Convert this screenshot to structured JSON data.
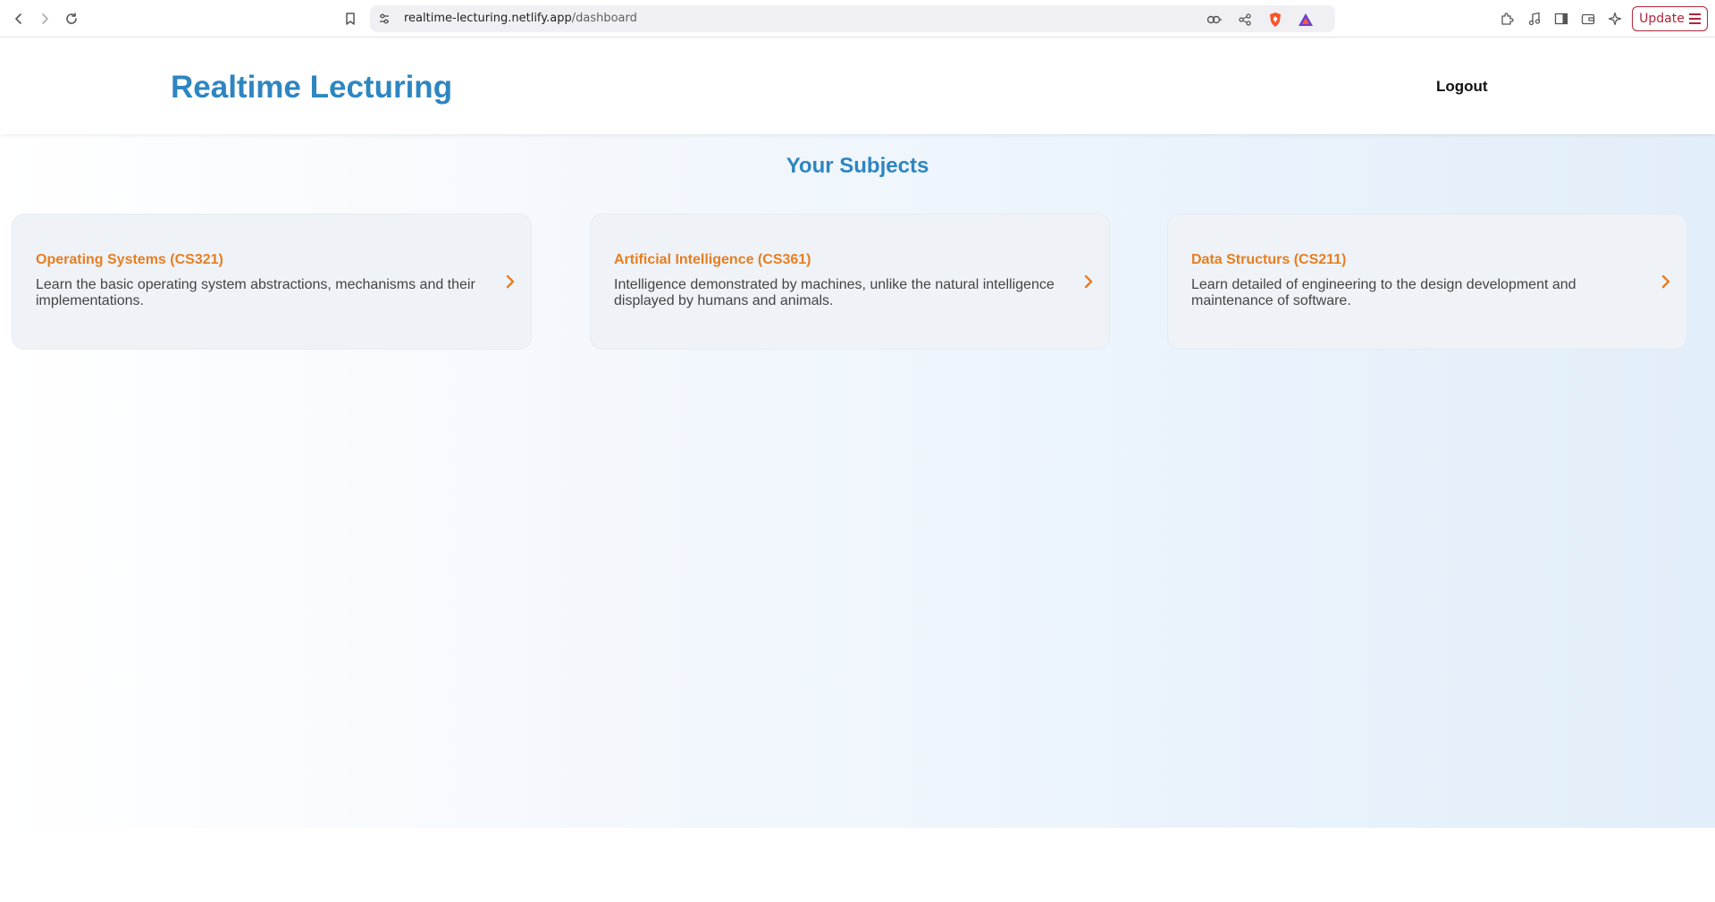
{
  "browser": {
    "url_host": "realtime-lecturing.netlify.app",
    "url_path": "/dashboard",
    "update_label": "Update"
  },
  "header": {
    "title": "Realtime Lecturing",
    "logout_label": "Logout"
  },
  "main": {
    "section_title": "Your Subjects",
    "subjects": [
      {
        "title": "Operating Systems (CS321)",
        "description": "Learn the basic operating system abstractions, mechanisms and their implementations."
      },
      {
        "title": "Artificial Intelligence (CS361)",
        "description": "Intelligence demonstrated by machines, unlike the natural intelligence displayed by humans and animals."
      },
      {
        "title": "Data Structurs (CS211)",
        "description": "Learn detailed of engineering to the design development and maintenance of software."
      }
    ]
  },
  "colors": {
    "brand_blue": "#2e86c1",
    "accent_orange": "#e67e22",
    "update_red": "#b0253a"
  }
}
